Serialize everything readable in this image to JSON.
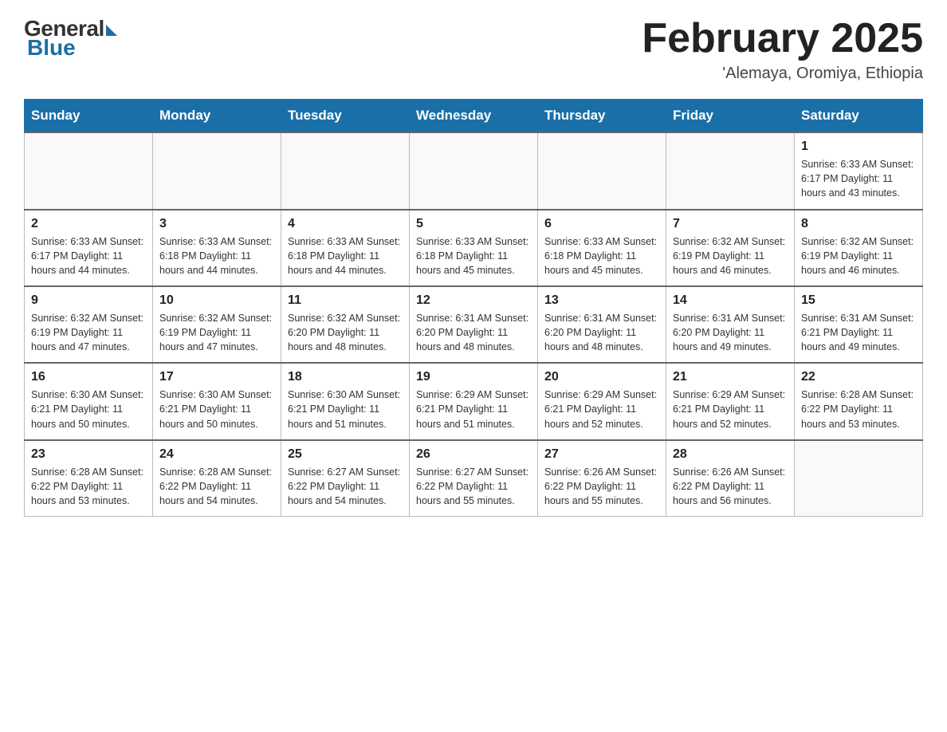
{
  "header": {
    "logo": {
      "general": "General",
      "blue": "Blue"
    },
    "title": "February 2025",
    "location": "'Alemaya, Oromiya, Ethiopia"
  },
  "days_of_week": [
    "Sunday",
    "Monday",
    "Tuesday",
    "Wednesday",
    "Thursday",
    "Friday",
    "Saturday"
  ],
  "weeks": [
    [
      {
        "day": "",
        "info": ""
      },
      {
        "day": "",
        "info": ""
      },
      {
        "day": "",
        "info": ""
      },
      {
        "day": "",
        "info": ""
      },
      {
        "day": "",
        "info": ""
      },
      {
        "day": "",
        "info": ""
      },
      {
        "day": "1",
        "info": "Sunrise: 6:33 AM\nSunset: 6:17 PM\nDaylight: 11 hours and 43 minutes."
      }
    ],
    [
      {
        "day": "2",
        "info": "Sunrise: 6:33 AM\nSunset: 6:17 PM\nDaylight: 11 hours and 44 minutes."
      },
      {
        "day": "3",
        "info": "Sunrise: 6:33 AM\nSunset: 6:18 PM\nDaylight: 11 hours and 44 minutes."
      },
      {
        "day": "4",
        "info": "Sunrise: 6:33 AM\nSunset: 6:18 PM\nDaylight: 11 hours and 44 minutes."
      },
      {
        "day": "5",
        "info": "Sunrise: 6:33 AM\nSunset: 6:18 PM\nDaylight: 11 hours and 45 minutes."
      },
      {
        "day": "6",
        "info": "Sunrise: 6:33 AM\nSunset: 6:18 PM\nDaylight: 11 hours and 45 minutes."
      },
      {
        "day": "7",
        "info": "Sunrise: 6:32 AM\nSunset: 6:19 PM\nDaylight: 11 hours and 46 minutes."
      },
      {
        "day": "8",
        "info": "Sunrise: 6:32 AM\nSunset: 6:19 PM\nDaylight: 11 hours and 46 minutes."
      }
    ],
    [
      {
        "day": "9",
        "info": "Sunrise: 6:32 AM\nSunset: 6:19 PM\nDaylight: 11 hours and 47 minutes."
      },
      {
        "day": "10",
        "info": "Sunrise: 6:32 AM\nSunset: 6:19 PM\nDaylight: 11 hours and 47 minutes."
      },
      {
        "day": "11",
        "info": "Sunrise: 6:32 AM\nSunset: 6:20 PM\nDaylight: 11 hours and 48 minutes."
      },
      {
        "day": "12",
        "info": "Sunrise: 6:31 AM\nSunset: 6:20 PM\nDaylight: 11 hours and 48 minutes."
      },
      {
        "day": "13",
        "info": "Sunrise: 6:31 AM\nSunset: 6:20 PM\nDaylight: 11 hours and 48 minutes."
      },
      {
        "day": "14",
        "info": "Sunrise: 6:31 AM\nSunset: 6:20 PM\nDaylight: 11 hours and 49 minutes."
      },
      {
        "day": "15",
        "info": "Sunrise: 6:31 AM\nSunset: 6:21 PM\nDaylight: 11 hours and 49 minutes."
      }
    ],
    [
      {
        "day": "16",
        "info": "Sunrise: 6:30 AM\nSunset: 6:21 PM\nDaylight: 11 hours and 50 minutes."
      },
      {
        "day": "17",
        "info": "Sunrise: 6:30 AM\nSunset: 6:21 PM\nDaylight: 11 hours and 50 minutes."
      },
      {
        "day": "18",
        "info": "Sunrise: 6:30 AM\nSunset: 6:21 PM\nDaylight: 11 hours and 51 minutes."
      },
      {
        "day": "19",
        "info": "Sunrise: 6:29 AM\nSunset: 6:21 PM\nDaylight: 11 hours and 51 minutes."
      },
      {
        "day": "20",
        "info": "Sunrise: 6:29 AM\nSunset: 6:21 PM\nDaylight: 11 hours and 52 minutes."
      },
      {
        "day": "21",
        "info": "Sunrise: 6:29 AM\nSunset: 6:21 PM\nDaylight: 11 hours and 52 minutes."
      },
      {
        "day": "22",
        "info": "Sunrise: 6:28 AM\nSunset: 6:22 PM\nDaylight: 11 hours and 53 minutes."
      }
    ],
    [
      {
        "day": "23",
        "info": "Sunrise: 6:28 AM\nSunset: 6:22 PM\nDaylight: 11 hours and 53 minutes."
      },
      {
        "day": "24",
        "info": "Sunrise: 6:28 AM\nSunset: 6:22 PM\nDaylight: 11 hours and 54 minutes."
      },
      {
        "day": "25",
        "info": "Sunrise: 6:27 AM\nSunset: 6:22 PM\nDaylight: 11 hours and 54 minutes."
      },
      {
        "day": "26",
        "info": "Sunrise: 6:27 AM\nSunset: 6:22 PM\nDaylight: 11 hours and 55 minutes."
      },
      {
        "day": "27",
        "info": "Sunrise: 6:26 AM\nSunset: 6:22 PM\nDaylight: 11 hours and 55 minutes."
      },
      {
        "day": "28",
        "info": "Sunrise: 6:26 AM\nSunset: 6:22 PM\nDaylight: 11 hours and 56 minutes."
      },
      {
        "day": "",
        "info": ""
      }
    ]
  ]
}
